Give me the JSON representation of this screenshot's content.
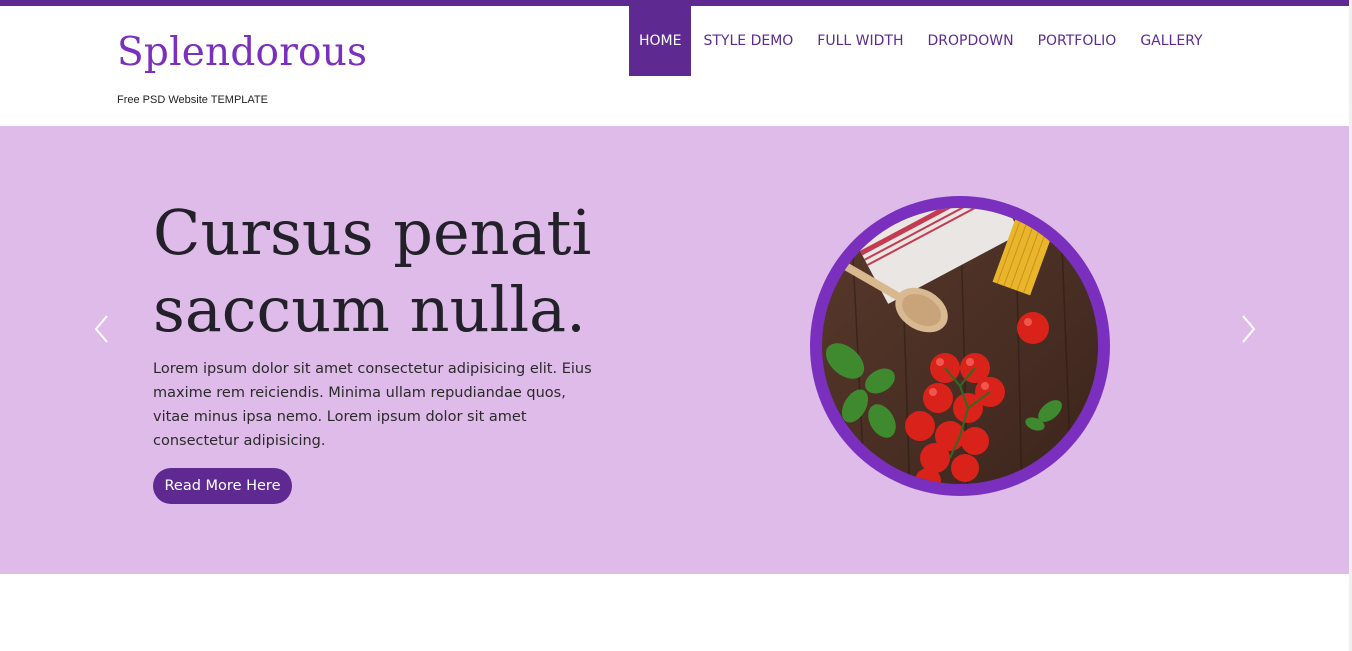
{
  "brand": {
    "name": "Splendorous",
    "tagline": "Free PSD Website TEMPLATE"
  },
  "nav": {
    "items": [
      {
        "label": "HOME",
        "active": true
      },
      {
        "label": "STYLE DEMO",
        "active": false
      },
      {
        "label": "FULL WIDTH",
        "active": false
      },
      {
        "label": "DROPDOWN",
        "active": false
      },
      {
        "label": "PORTFOLIO",
        "active": false
      },
      {
        "label": "GALLERY",
        "active": false
      }
    ]
  },
  "hero": {
    "headline_line1": "Cursus penati",
    "headline_line2": "saccum nulla.",
    "description": "Lorem ipsum dolor sit amet consectetur adipisicing elit. Eius maxime rem reiciendis. Minima ullam repudiandae quos, vitae minus ipsa nemo. Lorem ipsum dolor sit amet consectetur adipisicing.",
    "button_label": "Read More Here",
    "prev_icon": "chevron-left-icon",
    "next_icon": "chevron-right-icon",
    "image": "food-ingredients-photo"
  },
  "colors": {
    "accent": "#5e2a91",
    "logo": "#7b2fbe",
    "hero_bg": "#dfbbe9",
    "circle_ring": "#7b2fbe"
  }
}
